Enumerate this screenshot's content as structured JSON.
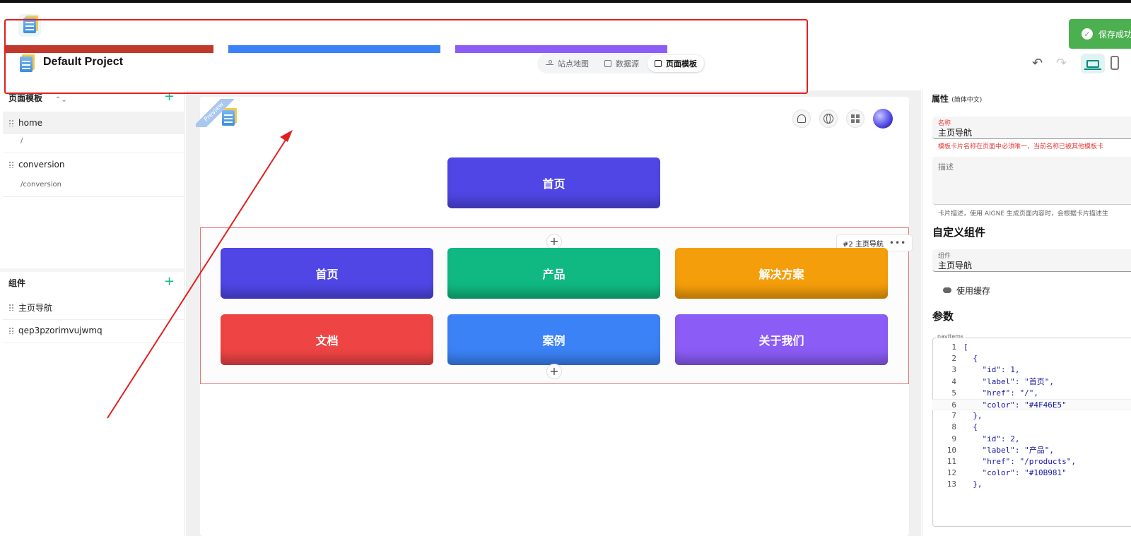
{
  "header": {
    "project_title": "Default Project",
    "view_tabs": [
      {
        "label": "站点地图",
        "icon": "sitemap-icon",
        "active": false
      },
      {
        "label": "数据源",
        "icon": "database-icon",
        "active": false
      },
      {
        "label": "页面模板",
        "icon": "template-icon",
        "active": true
      }
    ],
    "toast": "保存成功",
    "color_bars": [
      "#C0392B",
      "#3B82F6",
      "#8B5CF6"
    ]
  },
  "sidebar": {
    "templates_title": "页面模板",
    "templates": [
      {
        "name": "home",
        "path": "/",
        "selected": true
      },
      {
        "name": "conversion",
        "path": "/conversion",
        "selected": false
      }
    ],
    "components_title": "组件",
    "components": [
      {
        "name": "主页导航"
      },
      {
        "name": "qep3pzorimvujwmq"
      }
    ]
  },
  "canvas": {
    "preview_label": "Preview",
    "hero_button": {
      "label": "首页",
      "color": "#4F46E5"
    },
    "component_tag": "#2 主页导航",
    "nav_items": [
      {
        "label": "首页",
        "color": "#4F46E5"
      },
      {
        "label": "产品",
        "color": "#10B981"
      },
      {
        "label": "解决方案",
        "color": "#F59E0B"
      },
      {
        "label": "文档",
        "color": "#EF4444"
      },
      {
        "label": "案例",
        "color": "#3B82F6"
      },
      {
        "label": "关于我们",
        "color": "#8B5CF6"
      }
    ]
  },
  "props": {
    "title": "属性",
    "lang": "(简体中文)",
    "name_label": "名称",
    "name_value": "主页导航",
    "name_error": "模板卡片名称在页面中必须唯一，当前名称已被其他模板卡",
    "desc_label": "描述",
    "desc_hint": "卡片描述，使用 AIGNE 生成页面内容时，会根据卡片描述生",
    "custom_title": "自定义组件",
    "component_label": "组件",
    "component_value": "主页导航",
    "cache_label": "使用缓存",
    "params_title": "参数",
    "code_label": "navItems",
    "code_lines": [
      {
        "n": "1",
        "t": "["
      },
      {
        "n": "2",
        "t": "  {"
      },
      {
        "n": "3",
        "t": "    \"id\": 1,"
      },
      {
        "n": "4",
        "t": "    \"label\": \"首页\","
      },
      {
        "n": "5",
        "t": "    \"href\": \"/\","
      },
      {
        "n": "6",
        "t": "    \"color\": \"#4F46E5\""
      },
      {
        "n": "7",
        "t": "  },"
      },
      {
        "n": "8",
        "t": "  {"
      },
      {
        "n": "9",
        "t": "    \"id\": 2,"
      },
      {
        "n": "10",
        "t": "    \"label\": \"产品\","
      },
      {
        "n": "11",
        "t": "    \"href\": \"/products\","
      },
      {
        "n": "12",
        "t": "    \"color\": \"#10B981\""
      },
      {
        "n": "13",
        "t": "  },"
      }
    ]
  }
}
